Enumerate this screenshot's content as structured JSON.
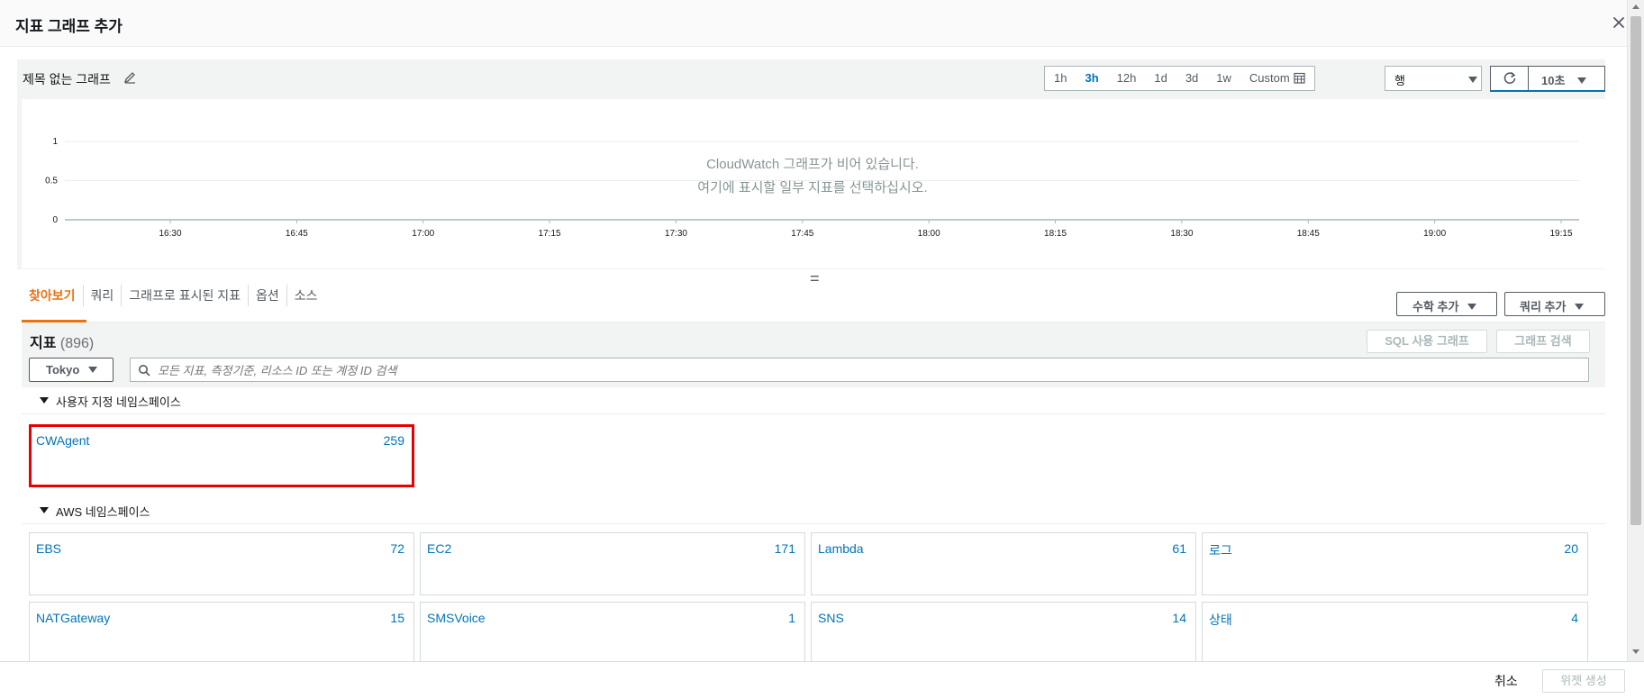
{
  "modal": {
    "title": "지표 그래프 추가"
  },
  "graph": {
    "title": "제목 없는 그래프",
    "time_ranges": [
      "1h",
      "3h",
      "12h",
      "1d",
      "3d",
      "1w",
      "Custom"
    ],
    "active_range": "3h",
    "style_value": "행",
    "refresh_interval": "10초",
    "empty_line1": "CloudWatch 그래프가 비어 있습니다.",
    "empty_line2": "여기에 표시할 일부 지표를 선택하십시오."
  },
  "chart_data": {
    "type": "line",
    "x_ticks": [
      "16:30",
      "16:45",
      "17:00",
      "17:15",
      "17:30",
      "17:45",
      "18:00",
      "18:15",
      "18:30",
      "18:45",
      "19:00",
      "19:15"
    ],
    "y_ticks": [
      "1",
      "0.5",
      "0"
    ],
    "ylim": [
      0,
      1
    ],
    "series": [],
    "grid": true
  },
  "tabs": [
    "찾아보기",
    "쿼리",
    "그래프로 표시된 지표",
    "옵션",
    "소스"
  ],
  "active_tab": "찾아보기",
  "actions": {
    "math": "수학 추가",
    "query": "쿼리 추가"
  },
  "metrics": {
    "title": "지표",
    "count": "(896)",
    "sql_button": "SQL 사용 그래프",
    "search_graph_button": "그래프 검색",
    "region": "Tokyo",
    "search_placeholder": "모든 지표, 측정기준, 리소스 ID 또는 계정 ID 검색",
    "custom_section": "사용자 지정 네임스페이스",
    "aws_section": "AWS 네임스페이스",
    "custom_namespaces": [
      {
        "name": "CWAgent",
        "count": "259"
      }
    ],
    "aws_namespaces": [
      {
        "name": "EBS",
        "count": "72"
      },
      {
        "name": "EC2",
        "count": "171"
      },
      {
        "name": "Lambda",
        "count": "61"
      },
      {
        "name": "로그",
        "count": "20"
      },
      {
        "name": "NATGateway",
        "count": "15"
      },
      {
        "name": "SMSVoice",
        "count": "1"
      },
      {
        "name": "SNS",
        "count": "14"
      },
      {
        "name": "상태",
        "count": "4"
      }
    ]
  },
  "footer": {
    "cancel": "취소",
    "create": "위젯 생성"
  },
  "colors": {
    "accent": "#ec7211",
    "link": "#0073bb",
    "highlight": "#e80000"
  }
}
